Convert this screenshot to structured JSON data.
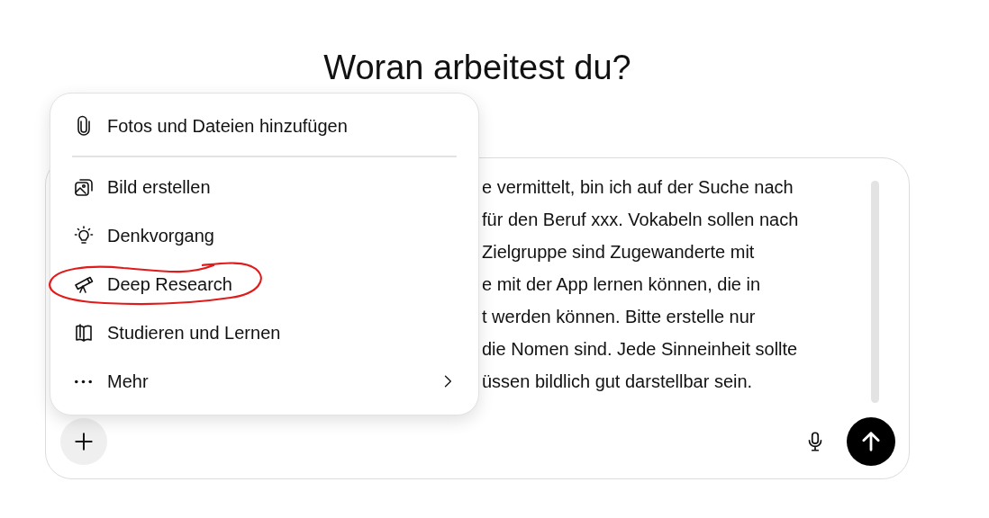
{
  "heading": "Woran arbeitest du?",
  "composer": {
    "lines": [
      "e vermittelt, bin ich auf der Suche nach",
      "für den Beruf xxx. Vokabeln sollen nach",
      "Zielgruppe sind Zugewanderte mit",
      "e mit der App lernen können, die in",
      "t werden können. Bitte erstelle nur",
      "die Nomen sind. Jede Sinneinheit sollte",
      "üssen bildlich gut darstellbar sein."
    ]
  },
  "menu": {
    "items": [
      {
        "kind": "attach",
        "label": "Fotos und Dateien hinzufügen",
        "annotated": false
      },
      {
        "kind": "image",
        "label": "Bild erstellen",
        "annotated": false
      },
      {
        "kind": "think",
        "label": "Denkvorgang",
        "annotated": false
      },
      {
        "kind": "research",
        "label": "Deep Research",
        "annotated": true
      },
      {
        "kind": "study",
        "label": "Studieren und Lernen",
        "annotated": false
      },
      {
        "kind": "more",
        "label": "Mehr",
        "annotated": false
      }
    ]
  }
}
